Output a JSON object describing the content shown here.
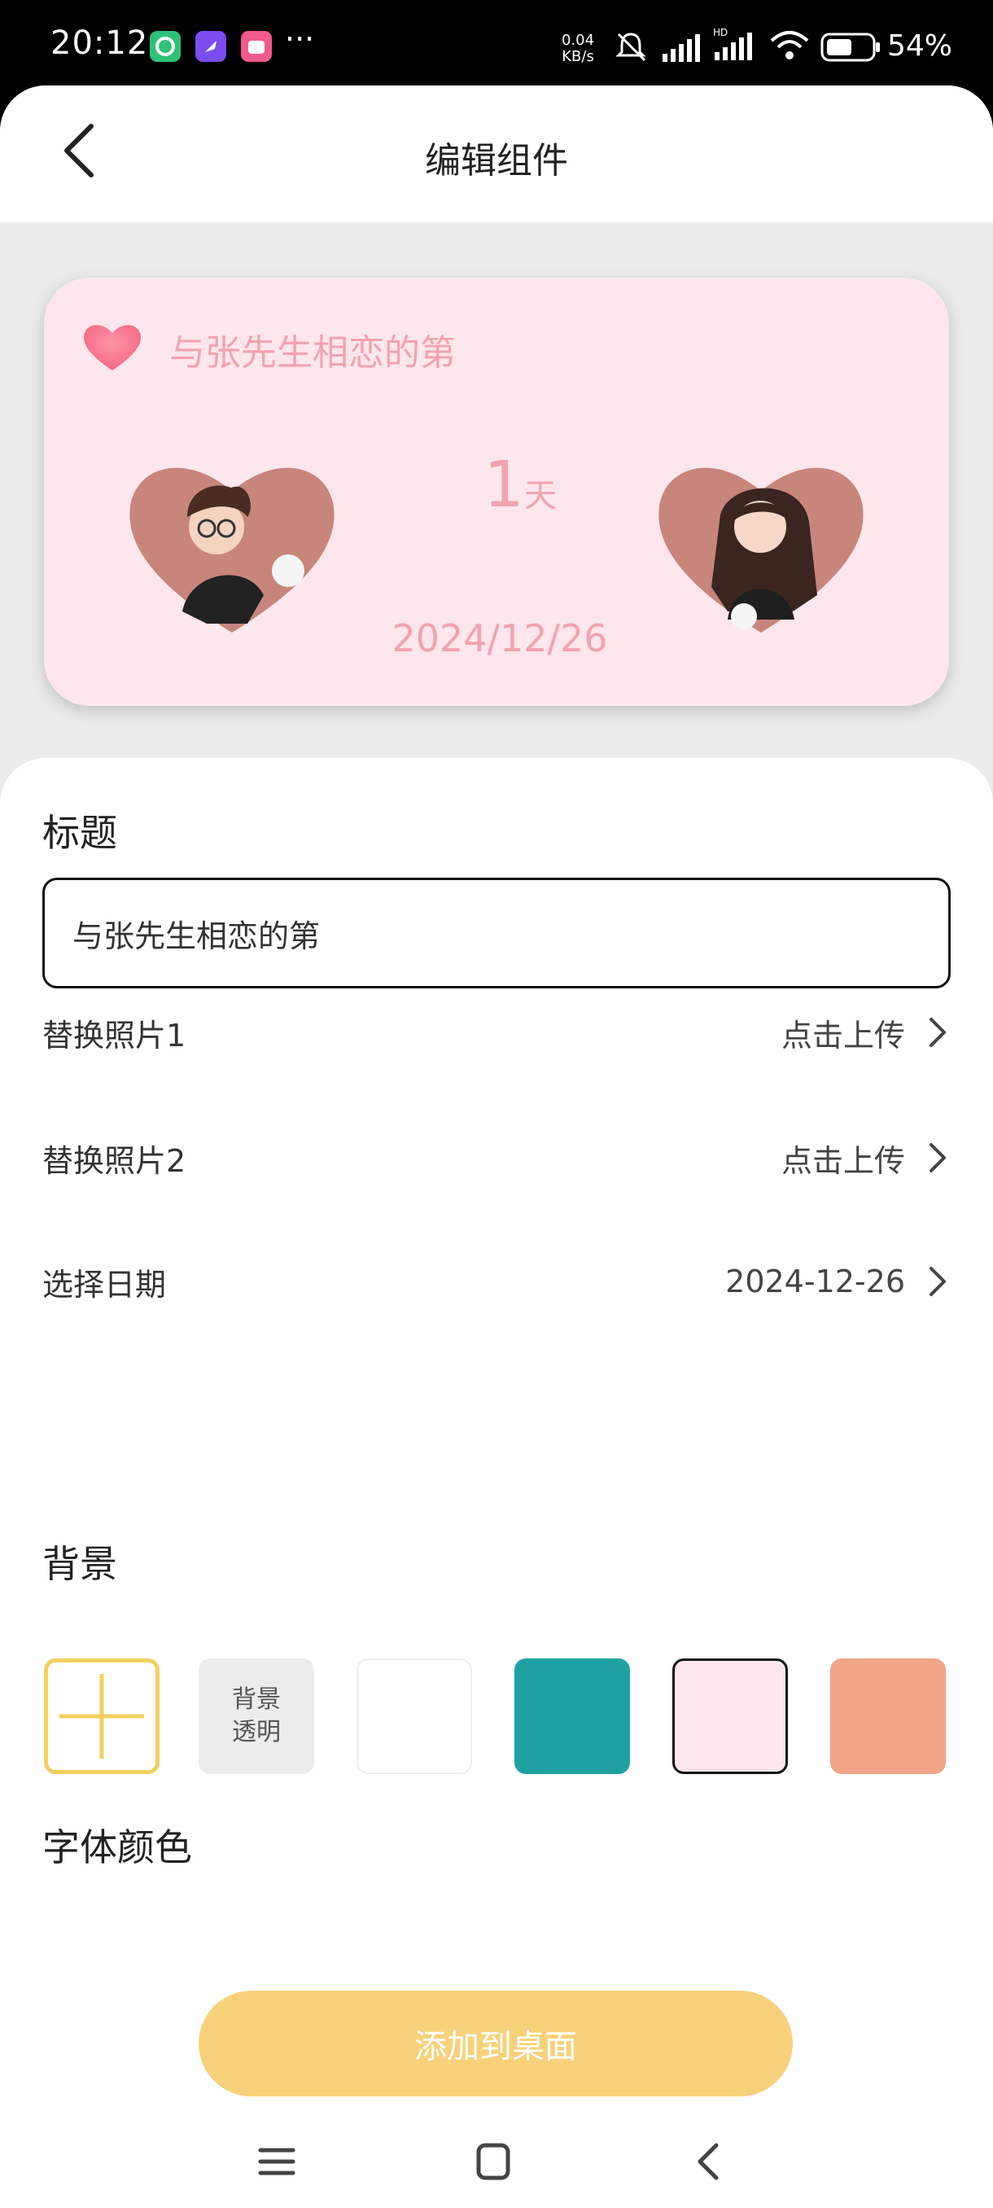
{
  "status_bar": {
    "time": "20:12",
    "more": "···",
    "network_speed_value": "0.04",
    "network_speed_unit": "KB/s",
    "battery": "54%",
    "app_icons": [
      "green-app-icon",
      "rocket-app-icon",
      "pink-app-icon"
    ]
  },
  "header": {
    "title": "编辑组件",
    "back_icon": "chevron-left-icon"
  },
  "widget_preview": {
    "title": "与张先生相恋的第",
    "days_number": "1",
    "days_unit": "天",
    "date": "2024/12/26",
    "accent_color": "#f2a3b0",
    "background_color": "#fde6ec"
  },
  "form": {
    "title_label": "标题",
    "title_value": "与张先生相恋的第",
    "rows": [
      {
        "label": "替换照片1",
        "value": "点击上传"
      },
      {
        "label": "替换照片2",
        "value": "点击上传"
      },
      {
        "label": "选择日期",
        "value": "2024-12-26"
      }
    ],
    "background_label": "背景",
    "transparent_label_line1": "背景",
    "transparent_label_line2": "透明",
    "swatches": [
      {
        "name": "custom",
        "color": "#ffffff"
      },
      {
        "name": "transparent",
        "color": "#ececec"
      },
      {
        "name": "white",
        "color": "#ffffff"
      },
      {
        "name": "teal",
        "color": "#1fa1a2"
      },
      {
        "name": "pink",
        "color": "#fde6ec",
        "selected": true
      },
      {
        "name": "salmon",
        "color": "#f2a587"
      }
    ],
    "font_color_label": "字体颜色",
    "submit_label": "添加到桌面",
    "submit_color": "#f8d27b"
  },
  "nav_bar": {
    "icons": [
      "menu-icon",
      "home-icon",
      "back-icon"
    ]
  }
}
